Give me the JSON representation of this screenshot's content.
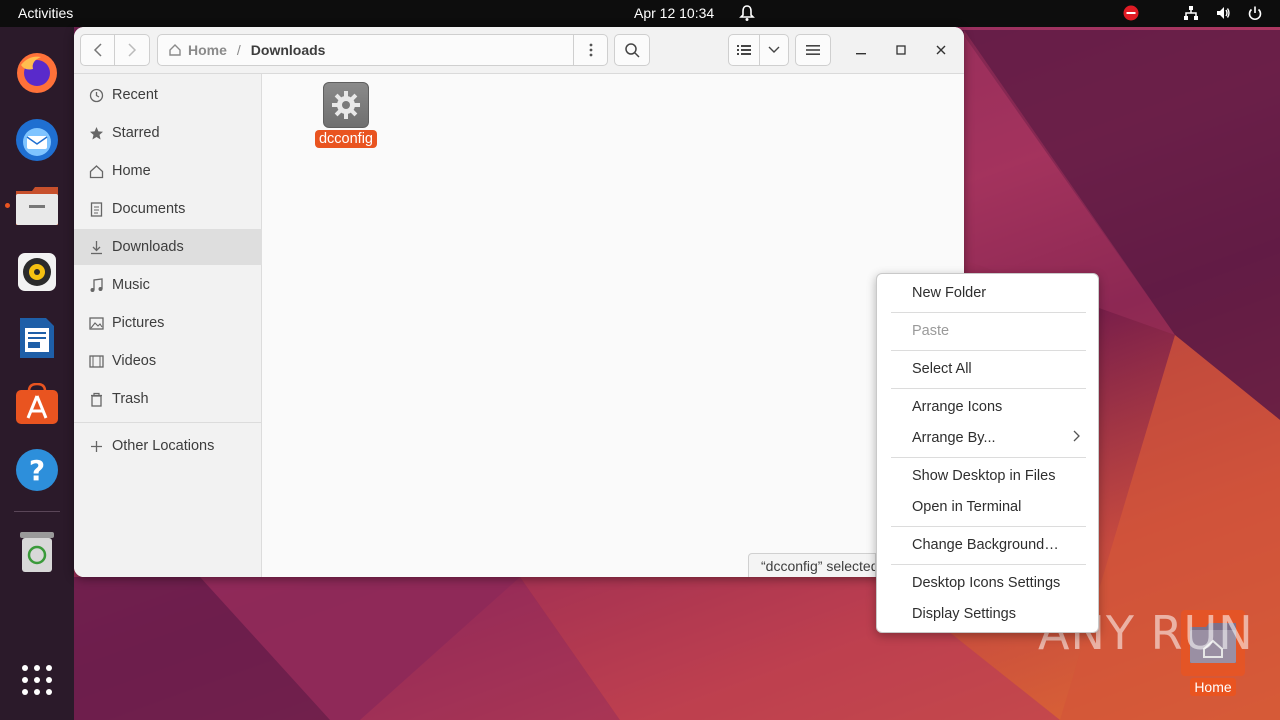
{
  "topbar": {
    "activities": "Activities",
    "clock": "Apr 12  10:34"
  },
  "dock": {
    "items": [
      "firefox-icon",
      "thunderbird-icon",
      "files-icon",
      "rhythmbox-icon",
      "libreoffice-writer-icon",
      "app-center-icon",
      "help-icon",
      "trash-icon",
      "show-apps-icon"
    ]
  },
  "files": {
    "pathbar": {
      "home": "Home",
      "current": "Downloads"
    },
    "sidebar": [
      {
        "label": "Recent",
        "icon": "clock-icon"
      },
      {
        "label": "Starred",
        "icon": "star-icon"
      },
      {
        "label": "Home",
        "icon": "home-icon"
      },
      {
        "label": "Documents",
        "icon": "document-icon"
      },
      {
        "label": "Downloads",
        "icon": "download-icon"
      },
      {
        "label": "Music",
        "icon": "music-icon"
      },
      {
        "label": "Pictures",
        "icon": "picture-icon"
      },
      {
        "label": "Videos",
        "icon": "video-icon"
      },
      {
        "label": "Trash",
        "icon": "trash-icon"
      },
      {
        "label": "Other Locations",
        "icon": "plus-icon"
      }
    ],
    "items": [
      {
        "name": "dcconfig"
      }
    ],
    "status": "“dcconfig” selected"
  },
  "context_menu": {
    "items": [
      {
        "label": "New Folder"
      },
      {
        "label": "Paste"
      },
      {
        "label": "Select All"
      },
      {
        "label": "Arrange Icons"
      },
      {
        "label": "Arrange By..."
      },
      {
        "label": "Show Desktop in Files"
      },
      {
        "label": "Open in Terminal"
      },
      {
        "label": "Change Background…"
      },
      {
        "label": "Desktop Icons Settings"
      },
      {
        "label": "Display Settings"
      }
    ]
  },
  "desktop": {
    "home_label": "Home",
    "watermark": "ANY RUN"
  },
  "colors": {
    "accent": "#e95420",
    "topbar": "#0d0d0d",
    "dock": "#2b1a2a"
  }
}
